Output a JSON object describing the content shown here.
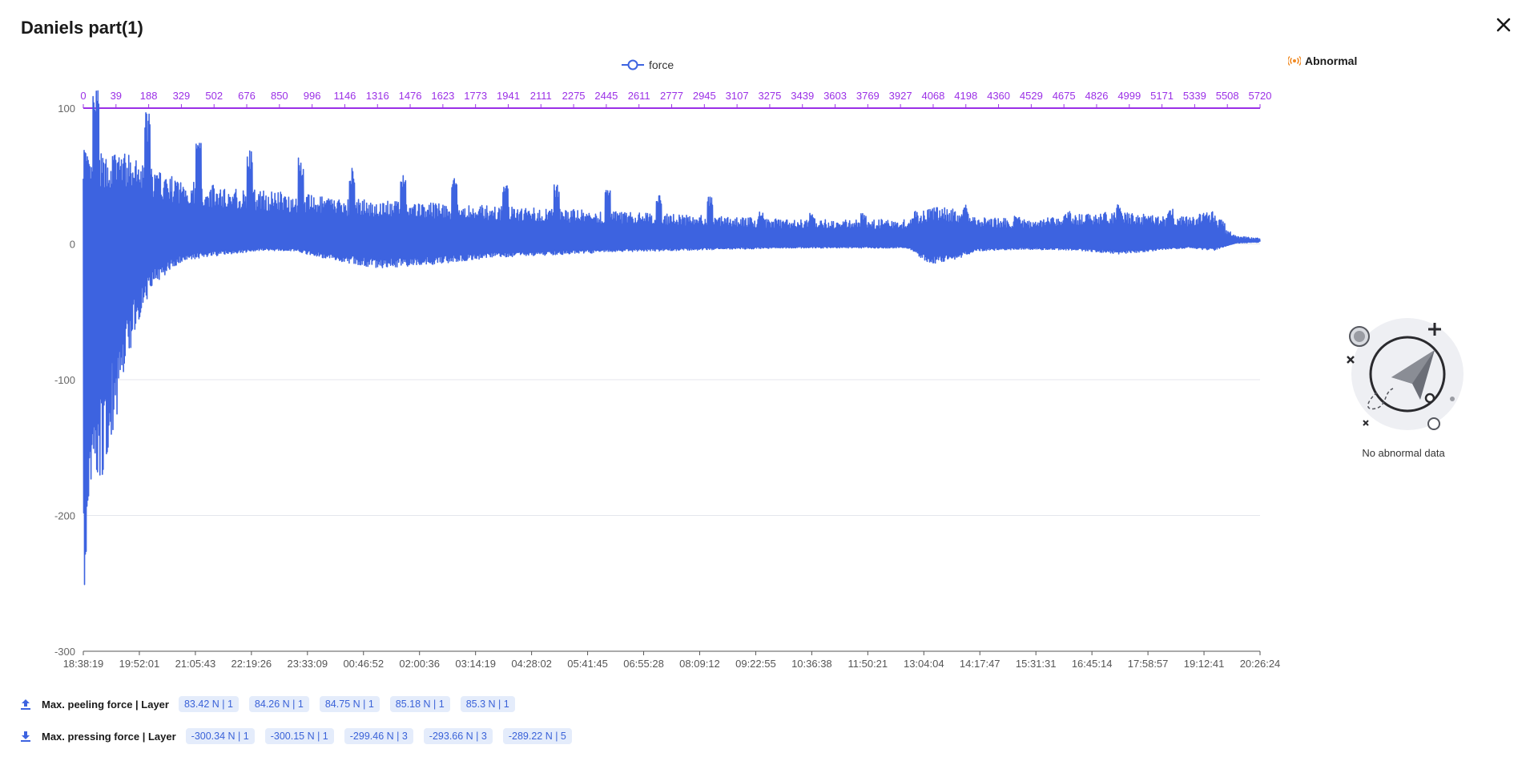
{
  "dialog": {
    "title": "Daniels part(1)",
    "close_icon": "close-icon"
  },
  "legend": {
    "label": "force",
    "color": "#3d63e0"
  },
  "abnormal": {
    "label": "Abnormal",
    "icon": "broadcast-icon",
    "icon_color": "#f08a24",
    "empty_text": "No abnormal data",
    "empty_icon": "paper-plane-illustration"
  },
  "stats": {
    "peeling": {
      "icon": "upload-arrow-icon",
      "label": "Max. peeling force | Layer",
      "values": [
        "83.42 N | 1",
        "84.26 N | 1",
        "84.75 N | 1",
        "85.18 N | 1",
        "85.3 N | 1"
      ]
    },
    "pressing": {
      "icon": "download-arrow-icon",
      "label": "Max. pressing force | Layer",
      "values": [
        "-300.34 N | 1",
        "-300.15 N | 1",
        "-299.46 N | 3",
        "-293.66 N | 3",
        "-289.22 N | 5"
      ]
    }
  },
  "chart_data": {
    "type": "line",
    "series": [
      {
        "name": "force",
        "color": "#3d63e0"
      }
    ],
    "ylim": [
      -300,
      100
    ],
    "yticks": [
      100,
      0,
      -100,
      -200,
      -300
    ],
    "x_bottom_ticks": [
      "18:38:19",
      "19:52:01",
      "21:05:43",
      "22:19:26",
      "23:33:09",
      "00:46:52",
      "02:00:36",
      "03:14:19",
      "04:28:02",
      "05:41:45",
      "06:55:28",
      "08:09:12",
      "09:22:55",
      "10:36:38",
      "11:50:21",
      "13:04:04",
      "14:17:47",
      "15:31:31",
      "16:45:14",
      "17:58:57",
      "19:12:41",
      "20:26:24"
    ],
    "x_top_ticks": [
      "0",
      "39",
      "188",
      "329",
      "502",
      "676",
      "850",
      "996",
      "1146",
      "1316",
      "1476",
      "1623",
      "1773",
      "1941",
      "2111",
      "2275",
      "2445",
      "2611",
      "2777",
      "2945",
      "3107",
      "3275",
      "3439",
      "3603",
      "3769",
      "3927",
      "4068",
      "4198",
      "4360",
      "4529",
      "4675",
      "4826",
      "4999",
      "5171",
      "5339",
      "5508",
      "5720"
    ],
    "x_top_color": "#9b30e6",
    "envelope_fraction": [
      0,
      0.005,
      0.01,
      0.02,
      0.03,
      0.045,
      0.06,
      0.08,
      0.1,
      0.12,
      0.15,
      0.18,
      0.2,
      0.25,
      0.3,
      0.35,
      0.4,
      0.45,
      0.5,
      0.55,
      0.6,
      0.65,
      0.7,
      0.72,
      0.74,
      0.76,
      0.8,
      0.85,
      0.88,
      0.9,
      0.92,
      0.94,
      0.96,
      0.97,
      0.98,
      1.0
    ],
    "envelope_max": [
      80,
      60,
      68,
      65,
      70,
      62,
      55,
      48,
      45,
      42,
      40,
      38,
      35,
      32,
      30,
      28,
      26,
      24,
      22,
      20,
      18,
      18,
      18,
      28,
      26,
      20,
      18,
      22,
      24,
      22,
      20,
      20,
      25,
      12,
      6,
      4
    ],
    "envelope_min": [
      -295,
      -215,
      -200,
      -160,
      -120,
      -60,
      -30,
      -15,
      -10,
      -8,
      -5,
      -5,
      -10,
      -18,
      -15,
      -10,
      -8,
      -6,
      -5,
      -4,
      -3,
      -3,
      -3,
      -15,
      -12,
      -5,
      -4,
      -5,
      -8,
      -6,
      -4,
      -3,
      -5,
      -2,
      1,
      2
    ],
    "grid": true,
    "legend_position": "top-center"
  }
}
